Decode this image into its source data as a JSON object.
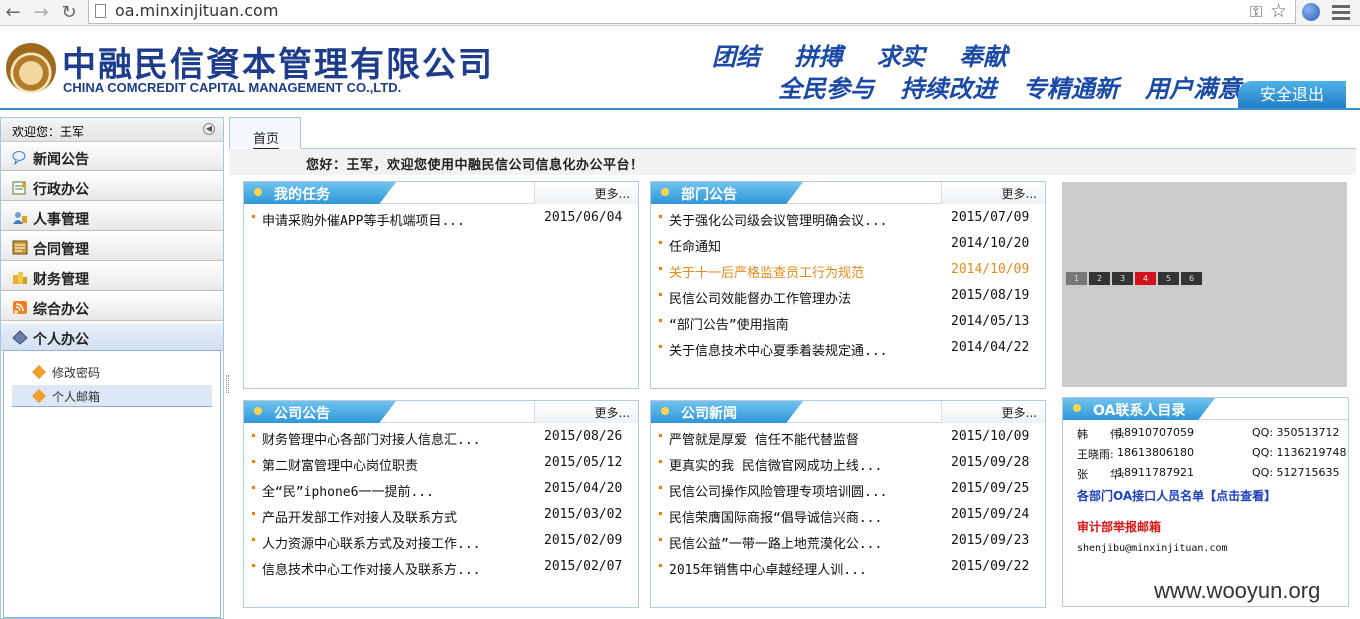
{
  "browser": {
    "url": "oa.minxinjituan.com"
  },
  "header": {
    "company_cn": "中融民信資本管理有限公司",
    "company_en": "CHINA COMCREDIT CAPITAL MANAGEMENT CO.,LTD.",
    "slogan_line1": "团结 拼搏 求实 奉献",
    "slogan_line2": "全民参与 持续改进 专精通新 用户满意",
    "logout_label": "安全退出"
  },
  "sidebar": {
    "welcome": "欢迎您：王军",
    "items": [
      {
        "label": "新闻公告",
        "icon": "news-icon"
      },
      {
        "label": "行政办公",
        "icon": "admin-icon"
      },
      {
        "label": "人事管理",
        "icon": "hr-icon"
      },
      {
        "label": "合同管理",
        "icon": "contract-icon"
      },
      {
        "label": "财务管理",
        "icon": "finance-icon"
      },
      {
        "label": "综合办公",
        "icon": "office-icon"
      },
      {
        "label": "个人办公",
        "icon": "personal-icon"
      }
    ],
    "subitems": [
      {
        "label": "修改密码"
      },
      {
        "label": "个人邮箱"
      }
    ]
  },
  "main": {
    "tab": "首页",
    "greeting": "您好：王军，欢迎您使用中融民信公司信息化办公平台！",
    "more_label": "更多...",
    "panels": {
      "tasks": {
        "title": "我的任务",
        "rows": [
          {
            "text": "申请采购外催APP等手机端项目...",
            "date": "2015/06/04"
          }
        ]
      },
      "dept": {
        "title": "部门公告",
        "rows": [
          {
            "text": "关于强化公司级会议管理明确会议...",
            "date": "2015/07/09"
          },
          {
            "text": "任命通知",
            "date": "2014/10/20"
          },
          {
            "text": "关于十一后严格监查员工行为规范",
            "date": "2014/10/09"
          },
          {
            "text": "民信公司效能督办工作管理办法",
            "date": "2015/08/19"
          },
          {
            "text": "“部门公告”使用指南",
            "date": "2014/05/13"
          },
          {
            "text": "关于信息技术中心夏季着装规定通...",
            "date": "2014/04/22"
          }
        ]
      },
      "company": {
        "title": "公司公告",
        "rows": [
          {
            "text": "财务管理中心各部门对接人信息汇...",
            "date": "2015/08/26"
          },
          {
            "text": "第二财富管理中心岗位职责",
            "date": "2015/05/12"
          },
          {
            "text": "全“民”iphone6一一提前...",
            "date": "2015/04/20"
          },
          {
            "text": "产品开发部工作对接人及联系方式",
            "date": "2015/03/02"
          },
          {
            "text": "人力资源中心联系方式及对接工作...",
            "date": "2015/02/09"
          },
          {
            "text": "信息技术中心工作对接人及联系方...",
            "date": "2015/02/07"
          }
        ]
      },
      "news": {
        "title": "公司新闻",
        "rows": [
          {
            "text": "严管就是厚爱 信任不能代替监督",
            "date": "2015/10/09"
          },
          {
            "text": "更真实的我 民信微官网成功上线...",
            "date": "2015/09/28"
          },
          {
            "text": "民信公司操作风险管理专项培训圆...",
            "date": "2015/09/25"
          },
          {
            "text": "民信荣膺国际商报“倡导诚信兴商...",
            "date": "2015/09/24"
          },
          {
            "text": "民信公益”一带一路上地荒漠化公...",
            "date": "2015/09/23"
          },
          {
            "text": "2015年销售中心卓越经理人训...",
            "date": "2015/09/22"
          }
        ]
      }
    },
    "slideshow": {
      "pages": [
        "1",
        "2",
        "3",
        "4",
        "5",
        "6"
      ],
      "active": 4
    },
    "contacts": {
      "title": "OA联系人目录",
      "people": [
        {
          "name": "韩　　伟:",
          "phone": "18910707059",
          "qq": "QQ: 350513712"
        },
        {
          "name": "王晓雨:",
          "phone": "18613806180",
          "qq": "QQ: 1136219748"
        },
        {
          "name": "张　　华:",
          "phone": "18911787921",
          "qq": "QQ: 512715635"
        }
      ],
      "dept_list_text": "各部门OA接口人员名单【点击查看】",
      "audit_title": "审计部举报邮箱",
      "audit_email": "shenjibu@minxinjituan.com"
    }
  },
  "watermark": "www.wooyun.org"
}
